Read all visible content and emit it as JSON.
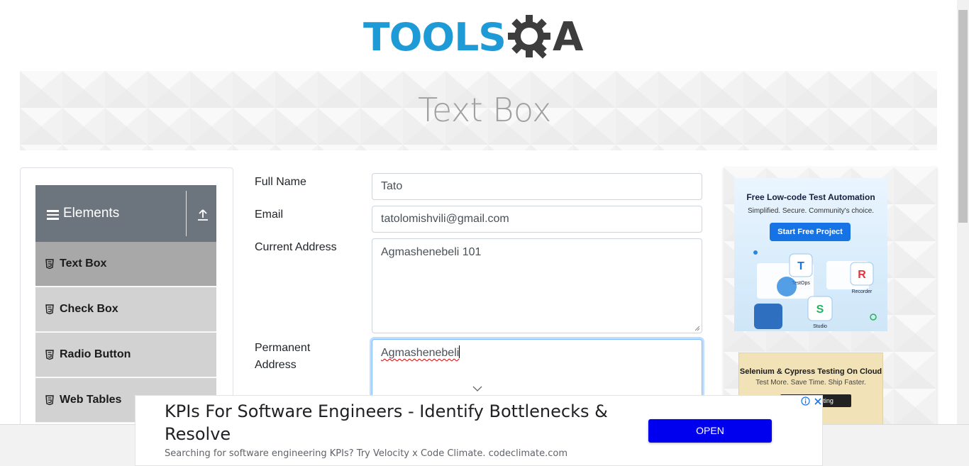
{
  "logo": {
    "tools_text": "TOOLS",
    "a_text": "A"
  },
  "banner": {
    "title": "Text Box"
  },
  "sidebar": {
    "group_title": "Elements",
    "items": [
      {
        "label": "Text Box",
        "active": true
      },
      {
        "label": "Check Box",
        "active": false
      },
      {
        "label": "Radio Button",
        "active": false
      },
      {
        "label": "Web Tables",
        "active": false
      }
    ]
  },
  "form": {
    "full_name_label": "Full Name",
    "full_name_value": "Tato",
    "email_label": "Email",
    "email_value": "tatolomishvili@gmail.com",
    "current_address_label": "Current Address",
    "current_address_value": "Agmashenebeli 101",
    "permanent_address_label_line1": "Permanent",
    "permanent_address_label_line2": "Address",
    "permanent_address_value": "Agmashenebeli"
  },
  "side_ads": {
    "ad1": {
      "title": "Free Low-code Test Automation",
      "subtitle": "Simplified. Secure. Community's choice.",
      "button": "Start Free Project",
      "tiles": [
        "TestOps",
        "Recorder",
        "Studio"
      ]
    },
    "ad2": {
      "title": "Selenium & Cypress Testing On Cloud",
      "subtitle": "Test More. Save Time. Ship Faster.",
      "button": "Start Testing"
    }
  },
  "bottom_ad": {
    "title": "KPIs For Software Engineers - Identify Bottlenecks & Resolve",
    "description": "Searching for software engineering KPIs? Try Velocity x Code Climate. codeclimate.com",
    "button": "OPEN"
  },
  "colors": {
    "brand_blue": "#1e9bd7",
    "brand_dark": "#3d3d3d",
    "sidebar_header": "#6c757d",
    "menu_active": "#a8a8a8",
    "menu_item": "#d2d2d2",
    "open_button": "#0000ee"
  }
}
